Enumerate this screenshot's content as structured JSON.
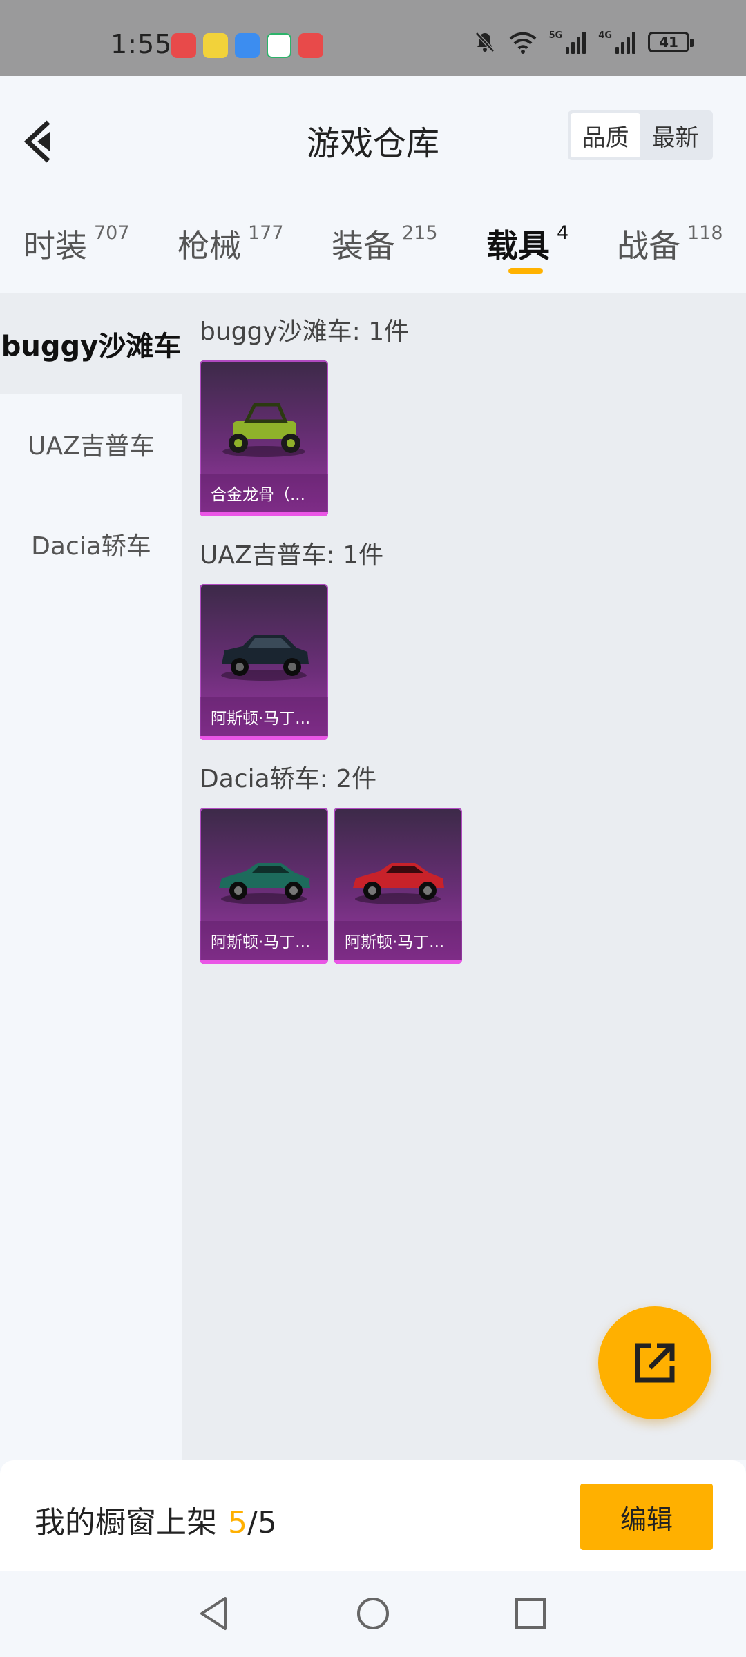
{
  "status_bar": {
    "time": "1:55",
    "signal_1_label": "5G",
    "signal_2_label": "4G",
    "battery": "41"
  },
  "header": {
    "title": "游戏仓库",
    "sort_options": [
      "品质",
      "最新"
    ],
    "active_sort": "品质"
  },
  "tabs": [
    {
      "label": "时装",
      "count": "707"
    },
    {
      "label": "枪械",
      "count": "177"
    },
    {
      "label": "装备",
      "count": "215"
    },
    {
      "label": "载具",
      "count": "4"
    },
    {
      "label": "战备",
      "count": "118"
    }
  ],
  "active_tab": "载具",
  "sidebar": {
    "items": [
      {
        "label": "buggy沙滩车"
      },
      {
        "label": "UAZ吉普车"
      },
      {
        "label": "Dacia轿车"
      }
    ]
  },
  "sections": [
    {
      "title": "buggy沙滩车: 1件",
      "items": [
        {
          "name": "合金龙骨（...",
          "color": "#8fb22a",
          "icon": "buggy-car-icon"
        }
      ]
    },
    {
      "title": "UAZ吉普车: 1件",
      "items": [
        {
          "name": "阿斯顿·马丁...",
          "color": "#1a2530",
          "icon": "suv-car-icon"
        }
      ]
    },
    {
      "title": "Dacia轿车: 2件",
      "items": [
        {
          "name": "阿斯顿·马丁...",
          "color": "#1d6b5c",
          "icon": "sports-car-icon"
        },
        {
          "name": "阿斯顿·马丁...",
          "color": "#c8222a",
          "icon": "sports-car-icon"
        }
      ]
    }
  ],
  "bottom": {
    "showcase_label": "我的橱窗上架",
    "showcase_count": "5",
    "showcase_total": "/5",
    "edit_label": "编辑"
  },
  "colors": {
    "accent": "#ffb000",
    "card_gradient_top": "#3c2a48",
    "card_gradient_bottom": "#9a3aa2",
    "card_bar": "#ea56e6"
  }
}
